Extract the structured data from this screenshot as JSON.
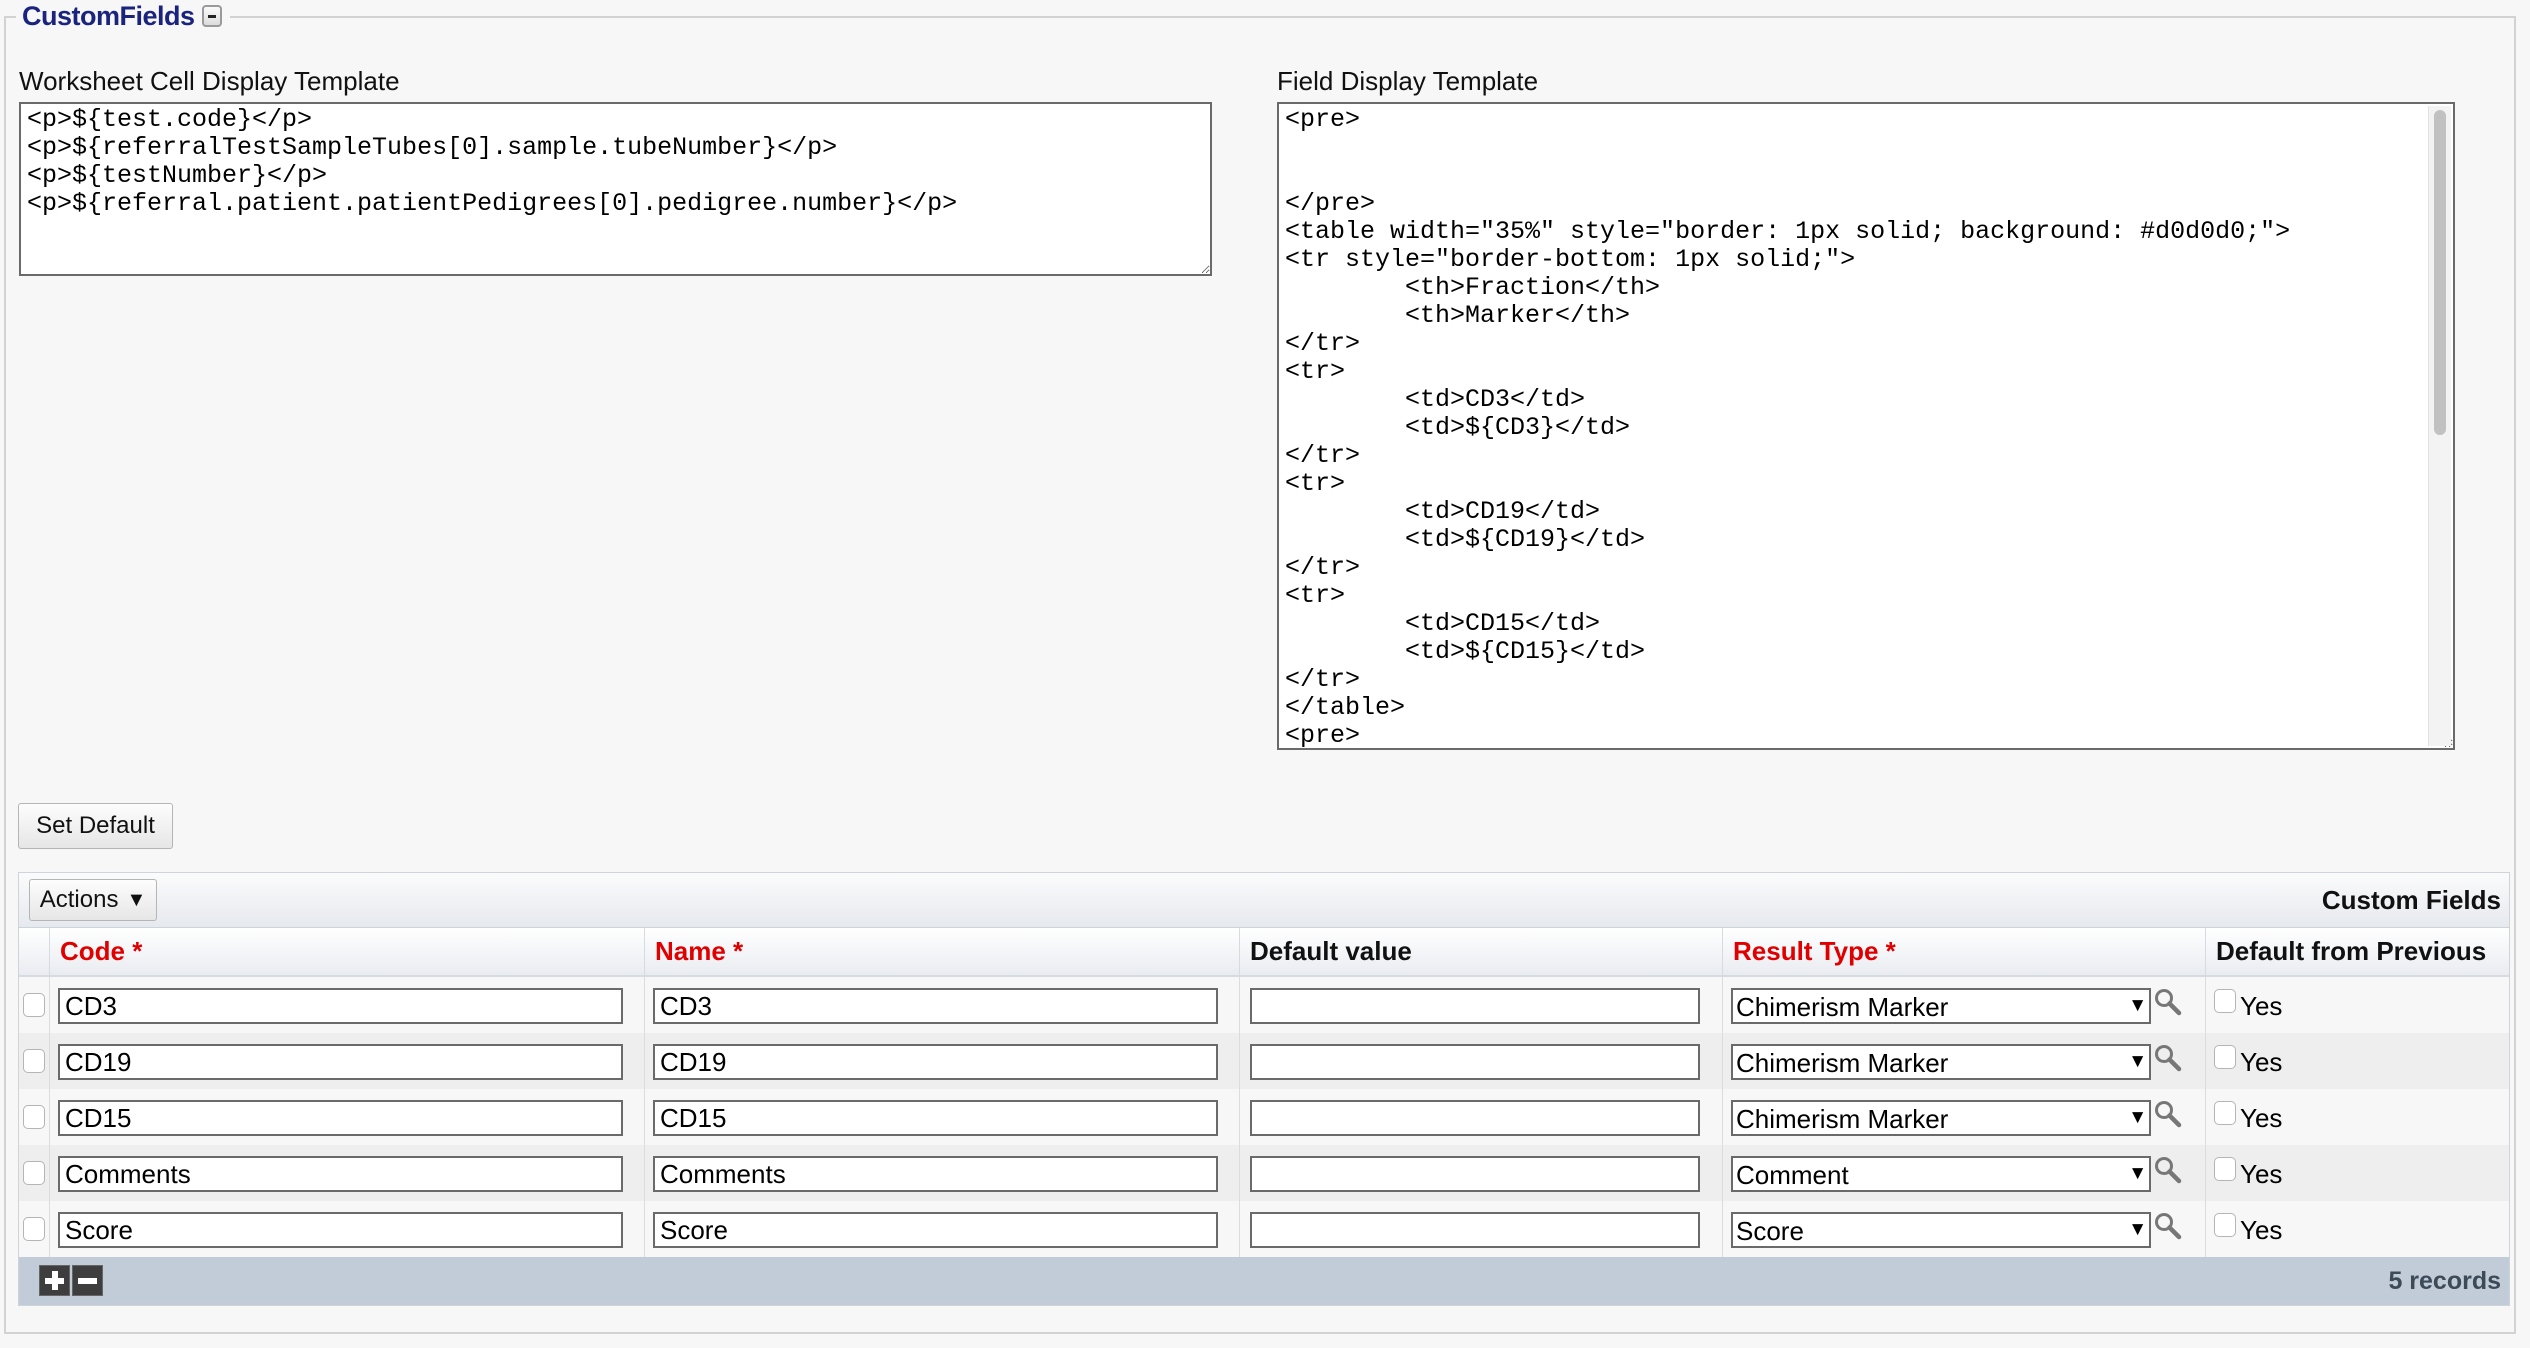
{
  "section": {
    "title": "CustomFields",
    "collapse_icon": "minus-box-icon"
  },
  "worksheet_template": {
    "label": "Worksheet Cell Display Template",
    "value": "<p>${test.code}</p>\n<p>${referralTestSampleTubes[0].sample.tubeNumber}</p>\n<p>${testNumber}</p>\n<p>${referral.patient.patientPedigrees[0].pedigree.number}</p>"
  },
  "field_template": {
    "label": "Field Display Template",
    "value": "<pre>\n\n\n</pre>\n<table width=\"35%\" style=\"border: 1px solid; background: #d0d0d0;\">\n<tr style=\"border-bottom: 1px solid;\">\n        <th>Fraction</th>\n        <th>Marker</th>\n</tr>\n<tr>\n        <td>CD3</td>\n        <td>${CD3}</td>\n</tr>\n<tr>\n        <td>CD19</td>\n        <td>${CD19}</td>\n</tr>\n<tr>\n        <td>CD15</td>\n        <td>${CD15}</td>\n</tr>\n</table>\n<pre>"
  },
  "buttons": {
    "set_default": "Set Default",
    "actions": "Actions",
    "actions_caret": "▼"
  },
  "grid": {
    "title": "Custom Fields",
    "columns": [
      {
        "label": "Code *",
        "required": true
      },
      {
        "label": "Name *",
        "required": true
      },
      {
        "label": "Default value",
        "required": false
      },
      {
        "label": "Result Type *",
        "required": true
      },
      {
        "label": "Default from Previous",
        "required": false
      }
    ],
    "rows": [
      {
        "code": "CD3",
        "name": "CD3",
        "default_value": "",
        "result_type": "Chimerism Marker",
        "default_from_previous": false,
        "yes_label": "Yes"
      },
      {
        "code": "CD19",
        "name": "CD19",
        "default_value": "",
        "result_type": "Chimerism Marker",
        "default_from_previous": false,
        "yes_label": "Yes"
      },
      {
        "code": "CD15",
        "name": "CD15",
        "default_value": "",
        "result_type": "Chimerism Marker",
        "default_from_previous": false,
        "yes_label": "Yes"
      },
      {
        "code": "Comments",
        "name": "Comments",
        "default_value": "",
        "result_type": "Comment",
        "default_from_previous": false,
        "yes_label": "Yes"
      },
      {
        "code": "Score",
        "name": "Score",
        "default_value": "",
        "result_type": "Score",
        "default_from_previous": false,
        "yes_label": "Yes"
      }
    ],
    "footer": {
      "records": "5 records",
      "add_icon": "plus-icon",
      "remove_icon": "minus-icon"
    },
    "select_arrow": "▼"
  },
  "colors": {
    "legend": "#1a237e",
    "required": "#e00000",
    "footer": "#c2ccd8"
  }
}
